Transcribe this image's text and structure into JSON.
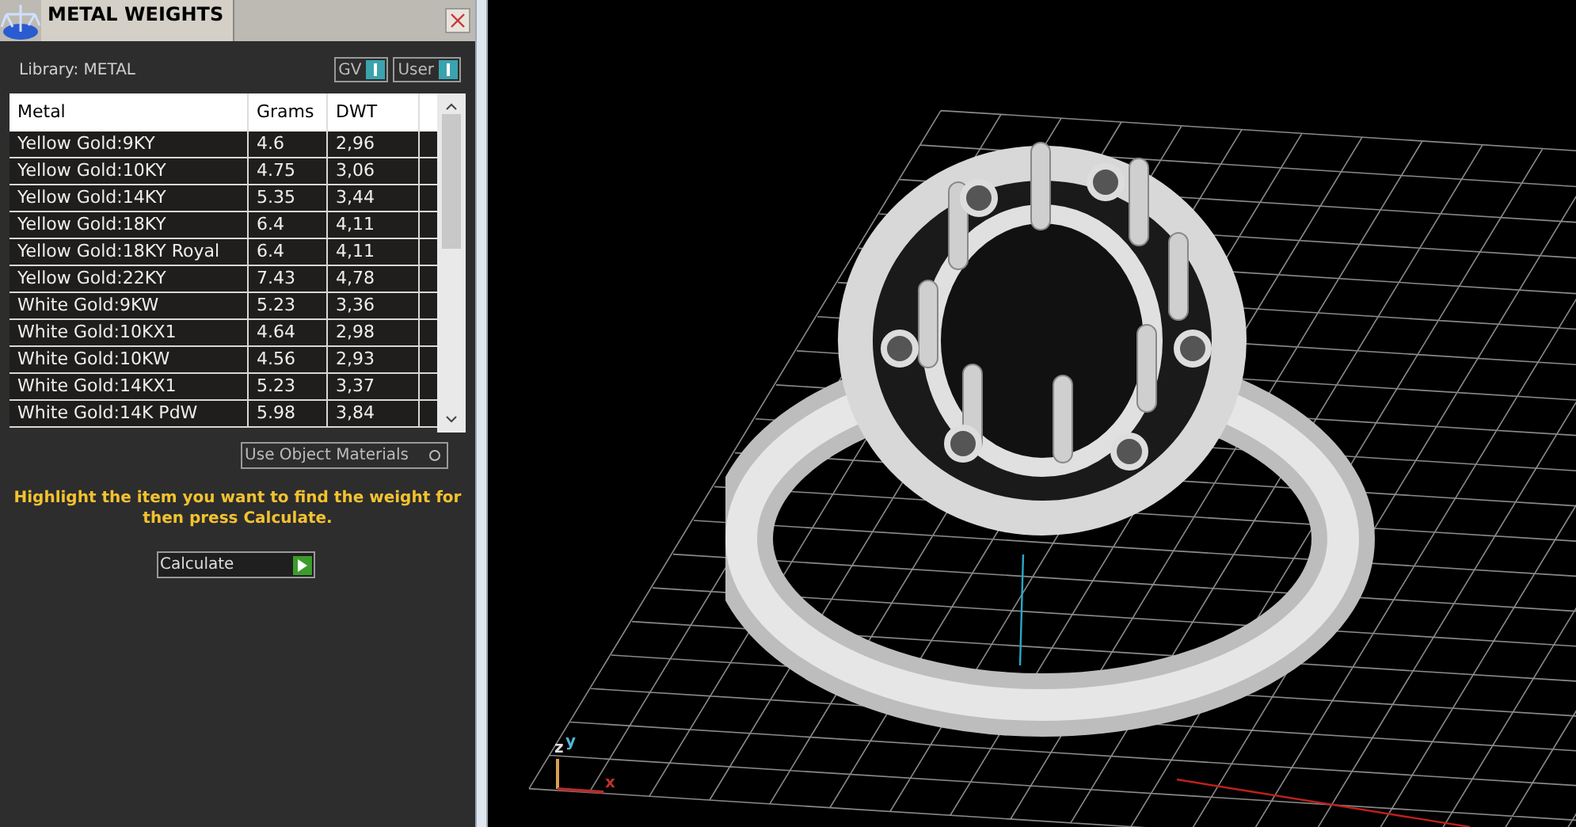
{
  "panel": {
    "title": "METAL WEIGHTS",
    "library_label": "Library: METAL",
    "toggles": [
      {
        "label": "GV",
        "on": true
      },
      {
        "label": "User",
        "on": true
      }
    ],
    "table": {
      "columns": [
        "Metal",
        "Grams",
        "DWT"
      ],
      "rows": [
        {
          "cells": [
            "Yellow Gold:9KY",
            "4.6",
            "2,96"
          ],
          "selected": false
        },
        {
          "cells": [
            "Yellow Gold:10KY",
            "4.75",
            "3,06"
          ],
          "selected": false
        },
        {
          "cells": [
            "Yellow Gold:14KY",
            "5.35",
            "3,44"
          ],
          "selected": false
        },
        {
          "cells": [
            "Yellow Gold:18KY",
            "6.4",
            "4,11"
          ],
          "selected": false
        },
        {
          "cells": [
            "Yellow Gold:18KY Royal",
            "6.4",
            "4,11"
          ],
          "selected": false
        },
        {
          "cells": [
            "Yellow Gold:22KY",
            "7.43",
            "4,78"
          ],
          "selected": false
        },
        {
          "cells": [
            "White Gold:9KW",
            "5.23",
            "3,36"
          ],
          "selected": false
        },
        {
          "cells": [
            "White Gold:10KX1",
            "4.64",
            "2,98"
          ],
          "selected": false
        },
        {
          "cells": [
            "White Gold:10KW",
            "4.56",
            "2,93"
          ],
          "selected": false
        },
        {
          "cells": [
            "White Gold:14KX1",
            "5.23",
            "3,37"
          ],
          "selected": false
        },
        {
          "cells": [
            "White Gold:14K PdW",
            "5.98",
            "3,84"
          ],
          "selected": false
        }
      ]
    },
    "use_object_materials": {
      "label": "Use Object Materials",
      "checked": false
    },
    "instruction": "Highlight the item you want to find the weight for then press Calculate.",
    "calculate_button": "Calculate"
  },
  "viewport": {
    "axis_labels": [
      "z",
      "y",
      "x"
    ]
  }
}
